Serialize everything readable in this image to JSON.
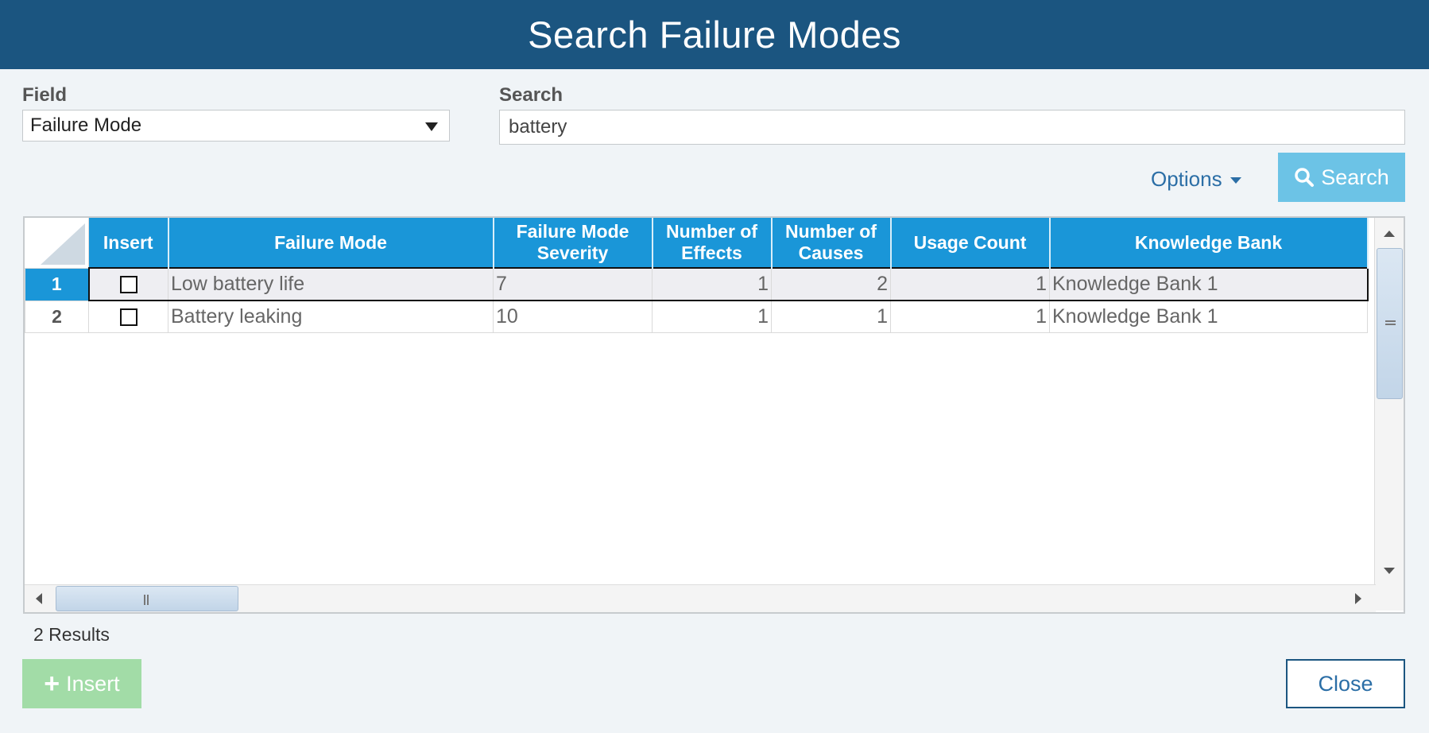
{
  "dialog": {
    "title": "Search Failure Modes"
  },
  "field": {
    "label": "Field",
    "value": "Failure Mode"
  },
  "search": {
    "label": "Search",
    "value": "battery"
  },
  "options_label": "Options",
  "search_button": "Search",
  "grid": {
    "columns": [
      "Insert",
      "Failure Mode",
      "Failure Mode Severity",
      "Number of Effects",
      "Number of Causes",
      "Usage Count",
      "Knowledge Bank"
    ],
    "rows": [
      {
        "num": "1",
        "checked": false,
        "failure_mode": "Low battery life",
        "severity": "7",
        "effects": "1",
        "causes": "2",
        "usage": "1",
        "bank": "Knowledge Bank 1",
        "selected": true
      },
      {
        "num": "2",
        "checked": false,
        "failure_mode": "Battery leaking",
        "severity": "10",
        "effects": "1",
        "causes": "1",
        "usage": "1",
        "bank": "Knowledge Bank 1",
        "selected": false
      }
    ]
  },
  "results_text": "2 Results",
  "insert_button": "Insert",
  "close_button": "Close",
  "colors": {
    "header": "#1b5580",
    "grid_header": "#1a96d8",
    "search_button": "#6cc3e6",
    "insert_button": "#a2dca7"
  }
}
